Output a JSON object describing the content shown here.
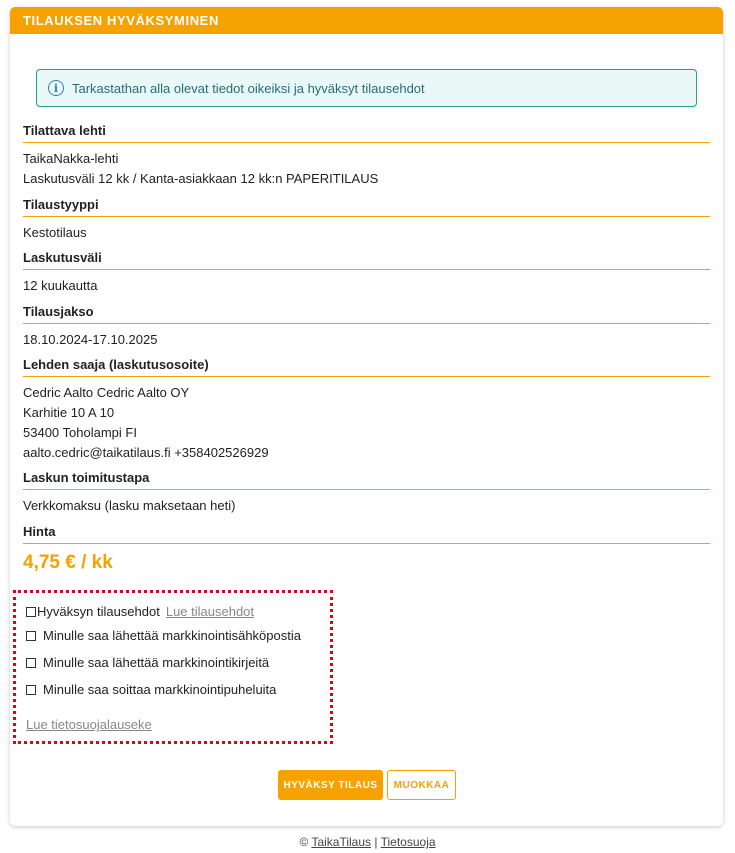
{
  "header": {
    "title": "TILAUKSEN HYVÄKSYMINEN"
  },
  "info": {
    "text": "Tarkastathan alla olevat tiedot oikeiksi ja hyväksyt tilausehdot"
  },
  "sections": {
    "lehti": {
      "title": "Tilattava lehti",
      "lines": [
        "TaikaNakka-lehti",
        "Laskutusväli 12 kk / Kanta-asiakkaan 12 kk:n PAPERITILAUS"
      ]
    },
    "tyyppi": {
      "title": "Tilaustyyppi",
      "lines": [
        "Kestotilaus"
      ]
    },
    "laskutusvali": {
      "title": "Laskutusväli",
      "lines": [
        "12 kuukautta"
      ]
    },
    "jakso": {
      "title": "Tilausjakso",
      "lines": [
        "18.10.2024-17.10.2025"
      ]
    },
    "saaja": {
      "title": "Lehden saaja (laskutusosoite)",
      "lines": [
        "Cedric Aalto Cedric Aalto OY",
        "Karhitie 10 A 10",
        "53400 Toholampi FI",
        "aalto.cedric@taikatilaus.fi +358402526929"
      ]
    },
    "toimitustapa": {
      "title": "Laskun toimitustapa",
      "lines": [
        "Verkkomaksu (lasku maksetaan heti)"
      ]
    },
    "hinta": {
      "title": "Hinta",
      "price": "4,75 € / kk"
    }
  },
  "consents": {
    "terms_label": "Hyväksyn tilausehdot",
    "terms_link": "Lue tilausehdot",
    "email_label": "Minulle saa lähettää markkinointisähköpostia",
    "letters_label": "Minulle saa lähettää markkinointikirjeitä",
    "calls_label": "Minulle saa soittaa markkinointipuheluita",
    "privacy_link": "Lue tietosuojalauseke"
  },
  "buttons": {
    "approve": "HYVÄKSY TILAUS",
    "edit": "MUOKKAA"
  },
  "footer": {
    "copyright": "©",
    "brand_link": "TaikaTilaus",
    "separator": "|",
    "privacy_link": "Tietosuoja"
  },
  "colors": {
    "accent": "#f5a100",
    "info_border": "#2a9d8f",
    "highlight_border": "#e0001b"
  }
}
